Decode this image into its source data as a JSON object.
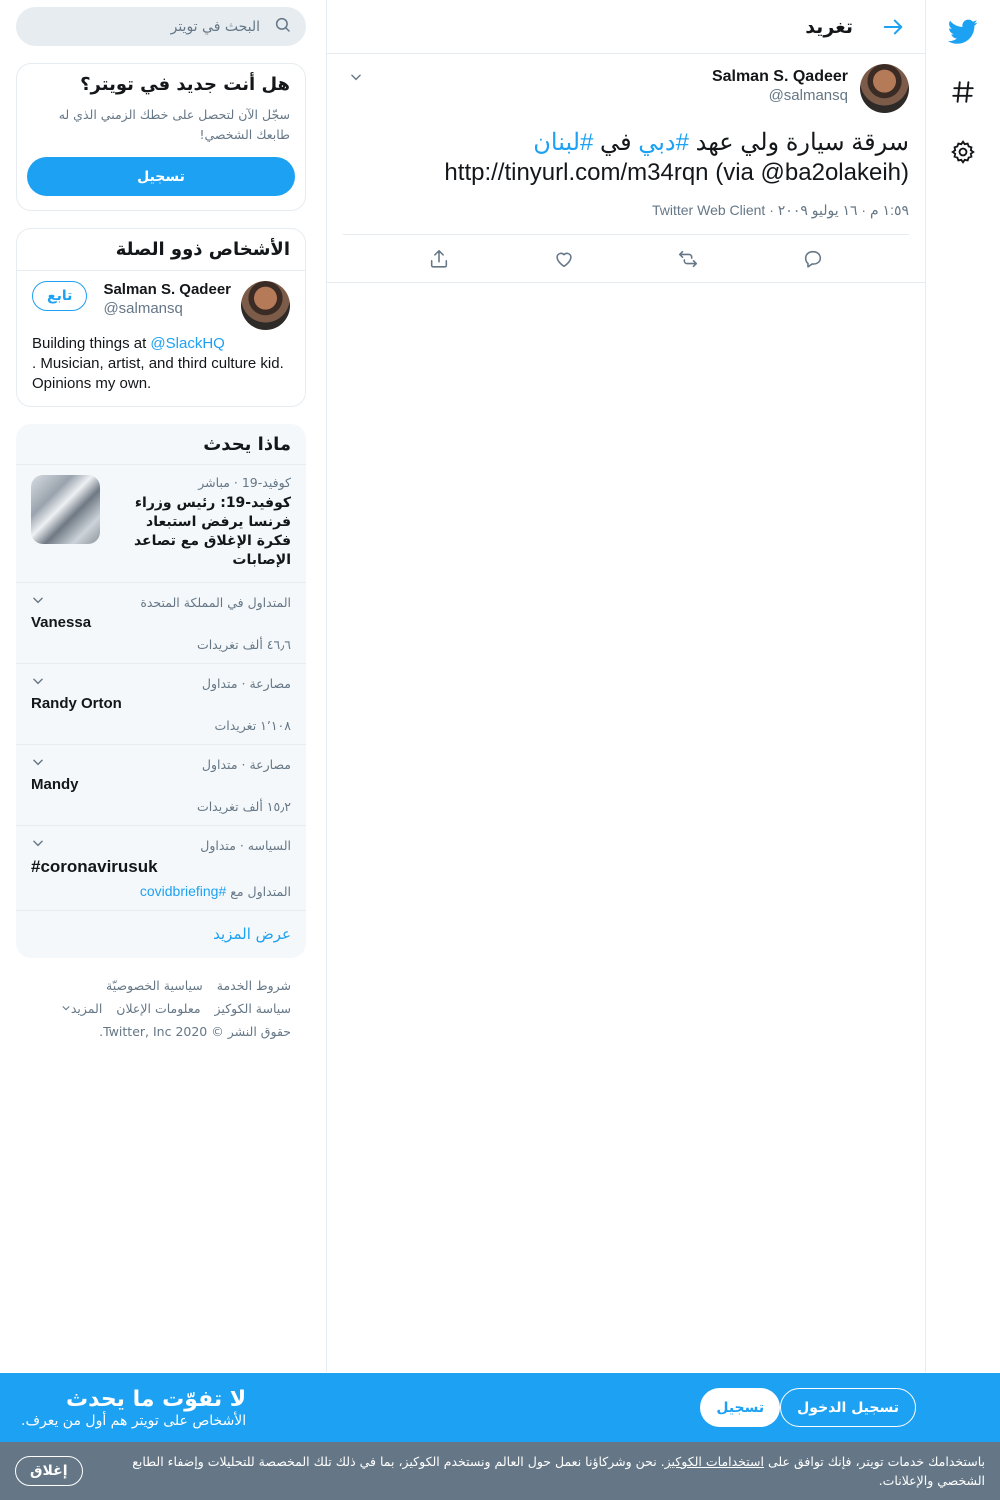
{
  "rail": {
    "logo_icon": "twitter-bird-icon",
    "explore_icon": "hashtag-icon",
    "settings_icon": "gear-icon"
  },
  "header": {
    "title": "تغريد"
  },
  "tweet": {
    "author_name": "Salman S. Qadeer",
    "author_handle": "@salmansq",
    "text_prefix": "سرقة سيارة ولي عهد ",
    "hashtag1": "#دبي",
    "text_mid": " في ",
    "hashtag2": "#لبنان",
    "text_link_line": "http://tinyurl.com/m34rqn (via @ba2olakeih)",
    "timestamp": "١:٥٩ م · ١٦ يوليو ٢٠٠٩",
    "source": "Twitter Web Client"
  },
  "search": {
    "placeholder": "البحث في تويتر"
  },
  "signup_card": {
    "title": "هل أنت جديد في تويتر؟",
    "subtitle": "سجّل الآن لتحصل على خطك الزمني الذي له طابعك الشخصي!",
    "button": "تسجيل"
  },
  "people": {
    "title": "الأشخاص ذوو الصلة",
    "name": "Salman S. Qadeer",
    "handle": "@salmansq",
    "follow": "تابع",
    "bio_start": "Building things at ",
    "bio_mention": "@SlackHQ",
    "bio_end": ". Musician, artist, and third culture kid. Opinions my own."
  },
  "trends": {
    "title": "ماذا يحدث",
    "news": {
      "meta": "كوفيد-19 · مباشر",
      "title": "كوفيد-19: رئيس وزراء فرنسا يرفض استبعاد فكرة الإغلاق مع تصاعد الإصابات"
    },
    "items": [
      {
        "context": "المتداول في المملكة المتحدة",
        "name": "Vanessa",
        "count": "٤٦٫٦ ألف تغريدات"
      },
      {
        "context": "مصارعة · متداول",
        "name": "Randy Orton",
        "count": "١٬١٠٨ تغريدات"
      },
      {
        "context": "مصارعة · متداول",
        "name": "Mandy",
        "count": "١٥٫٢ ألف تغريدات"
      },
      {
        "context": "السياسه · متداول",
        "name": "#coronavirusuk",
        "count_prefix": "المتداول مع ",
        "count_tag": "#covidbriefing"
      }
    ],
    "show_more": "عرض المزيد"
  },
  "footer": {
    "terms": "شروط الخدمة",
    "privacy": "سياسية الخصوصيّة",
    "cookies": "سياسة الكوكيز",
    "ads": "معلومات الإعلان",
    "more": "المزيد",
    "copyright": "حقوق النشر © 2020 Twitter, Inc."
  },
  "promo": {
    "title": "لا تفوّت ما يحدث",
    "subtitle": "الأشخاص على تويتر هم أول من يعرف.",
    "login": "تسجيل الدخول",
    "signup": "تسجيل"
  },
  "cookie": {
    "text_start": "باستخدامك خدمات تويتر، فإنك توافق على ",
    "link": "استخدامات الكوكيز",
    "text_end": ". نحن وشركاؤنا نعمل حول العالم ونستخدم الكوكيز، بما في ذلك تلك المخصصة للتحليلات وإضفاء الطابع الشخصي والإعلانات.",
    "close": "إغلاق"
  },
  "colors": {
    "accent": "#1da1f2",
    "muted": "#657786",
    "border": "#e6ecf0",
    "cookie_bg": "#657786"
  }
}
